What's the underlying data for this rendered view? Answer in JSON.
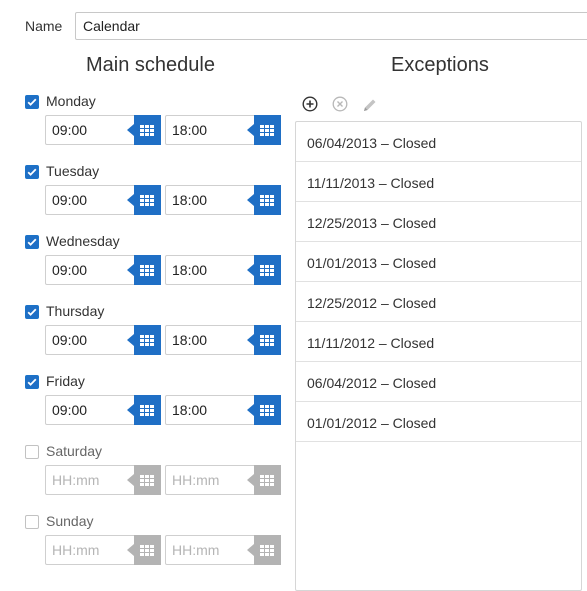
{
  "name_field": {
    "label": "Name",
    "value": "Calendar"
  },
  "main_schedule": {
    "title": "Main schedule",
    "days": [
      {
        "label": "Monday",
        "checked": true,
        "start": "09:00",
        "end": "18:00"
      },
      {
        "label": "Tuesday",
        "checked": true,
        "start": "09:00",
        "end": "18:00"
      },
      {
        "label": "Wednesday",
        "checked": true,
        "start": "09:00",
        "end": "18:00"
      },
      {
        "label": "Thursday",
        "checked": true,
        "start": "09:00",
        "end": "18:00"
      },
      {
        "label": "Friday",
        "checked": true,
        "start": "09:00",
        "end": "18:00"
      },
      {
        "label": "Saturday",
        "checked": false,
        "start": "",
        "end": ""
      },
      {
        "label": "Sunday",
        "checked": false,
        "start": "",
        "end": ""
      }
    ],
    "time_placeholder": "HH:mm",
    "picker_icon": "time-grid-icon"
  },
  "exceptions": {
    "title": "Exceptions",
    "toolbar": {
      "add_icon": "plus-circle-icon",
      "remove_icon": "x-circle-icon",
      "edit_icon": "pencil-icon"
    },
    "items": [
      "06/04/2013 – Closed",
      "11/11/2013 – Closed",
      "12/25/2013 – Closed",
      "01/01/2013 – Closed",
      "12/25/2012 – Closed",
      "11/11/2012 – Closed",
      "06/04/2012 – Closed",
      "01/01/2012 – Closed"
    ]
  },
  "colors": {
    "accent": "#1f6fc5",
    "disabled": "#b3b3b3",
    "border": "#cfcfcf"
  }
}
